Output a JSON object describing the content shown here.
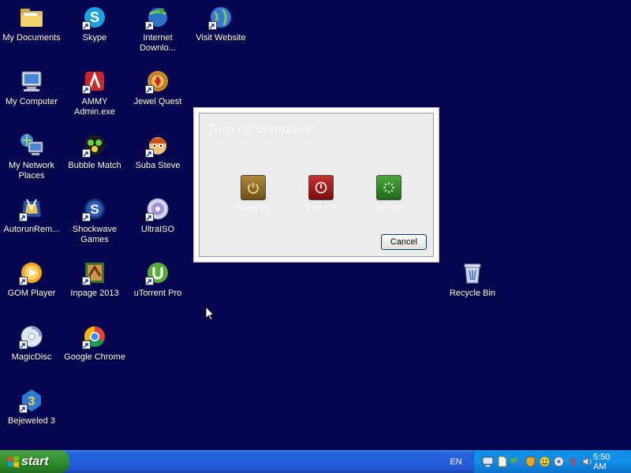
{
  "desktop": {
    "icons": [
      {
        "label": "My Documents",
        "icon": "my-documents-icon",
        "shortcut": false
      },
      {
        "label": "Skype",
        "icon": "skype-icon",
        "shortcut": true
      },
      {
        "label": "Internet Downlo...",
        "icon": "internet-download-manager-icon",
        "shortcut": true
      },
      {
        "label": "Visit Website",
        "icon": "globe-icon",
        "shortcut": true
      },
      {
        "label": "My Computer",
        "icon": "my-computer-icon",
        "shortcut": false
      },
      {
        "label": "AMMY Admin.exe",
        "icon": "ammy-admin-icon",
        "shortcut": true
      },
      {
        "label": "Jewel Quest",
        "icon": "jewel-quest-icon",
        "shortcut": true
      },
      {
        "label": "My Network Places",
        "icon": "network-places-icon",
        "shortcut": false
      },
      {
        "label": "Bubble Match",
        "icon": "bubble-match-icon",
        "shortcut": true
      },
      {
        "label": "Suba Steve",
        "icon": "suba-steve-icon",
        "shortcut": true
      },
      {
        "label": "AutorunRem...",
        "icon": "autorun-remover-icon",
        "shortcut": true
      },
      {
        "label": "Shockwave Games",
        "icon": "shockwave-icon",
        "shortcut": true
      },
      {
        "label": "UltraISO",
        "icon": "ultraiso-icon",
        "shortcut": true
      },
      {
        "label": "GOM Player",
        "icon": "gom-player-icon",
        "shortcut": true
      },
      {
        "label": "Inpage 2013",
        "icon": "inpage-icon",
        "shortcut": true
      },
      {
        "label": "uTorrent Pro",
        "icon": "utorrent-icon",
        "shortcut": true
      },
      {
        "label": "MagicDisc",
        "icon": "magicdisc-icon",
        "shortcut": true
      },
      {
        "label": "Google Chrome",
        "icon": "chrome-icon",
        "shortcut": true
      },
      {
        "label": "Bejeweled 3",
        "icon": "bejeweled-icon",
        "shortcut": true
      },
      {
        "label": "Recycle Bin",
        "icon": "recycle-bin-icon",
        "shortcut": false
      }
    ]
  },
  "dialog": {
    "title": "Turn off computer",
    "buttons": [
      {
        "label": "Stand By",
        "icon": "stand-by-icon",
        "color": "#8a6a1e"
      },
      {
        "label": "Turn Off",
        "icon": "turn-off-icon",
        "color": "#a11818"
      },
      {
        "label": "Restart",
        "icon": "restart-icon",
        "color": "#2f8a2a"
      }
    ],
    "cancel_label": "Cancel"
  },
  "taskbar": {
    "start_label": "start",
    "language": "EN",
    "clock": "5:50 AM",
    "tray_icons": [
      "monitor-icon",
      "notepad-icon",
      "network-icon",
      "shield-icon",
      "smiley-icon",
      "volume-icon",
      "skype-icon",
      "speaker-icon"
    ]
  }
}
